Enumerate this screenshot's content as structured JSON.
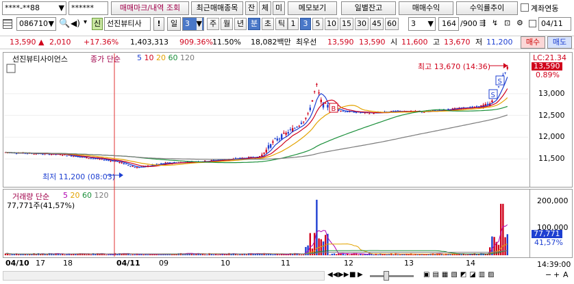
{
  "toolbar1": {
    "account": "****-**88",
    "password": "******",
    "trade_mark_btn": "매매마크/내역 조회",
    "recent_trades_btn": "최근매매종목",
    "balance_btn": "잔",
    "fill_btn": "체",
    "unfill_btn": "미",
    "memo_btn": "메모보기",
    "daily_balance_btn": "일별잔고",
    "trade_profit_btn": "매매수익",
    "return_trend_btn": "수익률추이",
    "account_link_label": "계좌연동"
  },
  "toolbar2": {
    "stock_code": "086710",
    "credit_badge": "신",
    "stock_name": "선진뷰티사",
    "alert_mark": "!",
    "period_label": "일",
    "period_value": "3",
    "period_units": [
      "주",
      "월",
      "년",
      "분",
      "초",
      "틱"
    ],
    "active_unit": "분",
    "intervals": [
      "1",
      "3",
      "5",
      "10",
      "15",
      "30",
      "45",
      "60"
    ],
    "active_interval": "3",
    "custom_interval": "3",
    "count_display": "164",
    "count_total": "/900",
    "date_value": "04/11"
  },
  "quote": {
    "price": "13,590",
    "change": "2,010",
    "change_pct": "+17.36%",
    "volume": "1,403,313",
    "volume_ratio": "909.36%",
    "turnover_rate": "11.50%",
    "amount": "18,082백만",
    "best_bid_label": "최우선",
    "best_ask": "13,590",
    "best_bid": "13,590",
    "open_label": "시",
    "open": "11,600",
    "high_label": "고",
    "high": "13,670",
    "low_label": "저",
    "low": "11,200",
    "buy_btn": "매수",
    "sell_btn": "매도"
  },
  "price_panel": {
    "stock_title": "선진뷰티사이언스",
    "indicator_title": "종가 단순",
    "ma_periods": [
      "5",
      "10",
      "20",
      "60",
      "120"
    ],
    "ma_colors": [
      "#1d3fd1",
      "#d0021b",
      "#e3a300",
      "#1a8f3a",
      "#7a7a7a"
    ],
    "high_annotation": "최고 13,670 (14:36)",
    "low_annotation": "최저 11,200 (08:03)",
    "lc_label": "LC:21.34",
    "current_tag": "13,590",
    "current_pct": "0.89%",
    "y_ticks": [
      "13,000",
      "12,500",
      "12,000",
      "11,500"
    ]
  },
  "volume_panel": {
    "title": "거래량 단순",
    "ma_periods": [
      "5",
      "20",
      "60",
      "120"
    ],
    "current_volume": "77,771주(41,57%)",
    "y_ticks": [
      "200,000",
      "100,000"
    ],
    "current_tag": "77,771",
    "current_pct": "41,57%"
  },
  "x_axis": {
    "labels": [
      "04/10",
      "17",
      "18",
      "04/11",
      "09",
      "10",
      "11",
      "12",
      "13",
      "14"
    ],
    "time_label": "14:39:00"
  },
  "chart_data": {
    "type": "candlestick",
    "title": "선진뷰티사이언스",
    "xlabel": "",
    "ylabel": "",
    "ylim": [
      11000,
      13800
    ],
    "volume_ylim": [
      0,
      230000
    ],
    "series_hint": "3-minute candles, price 11,200–13,670"
  }
}
